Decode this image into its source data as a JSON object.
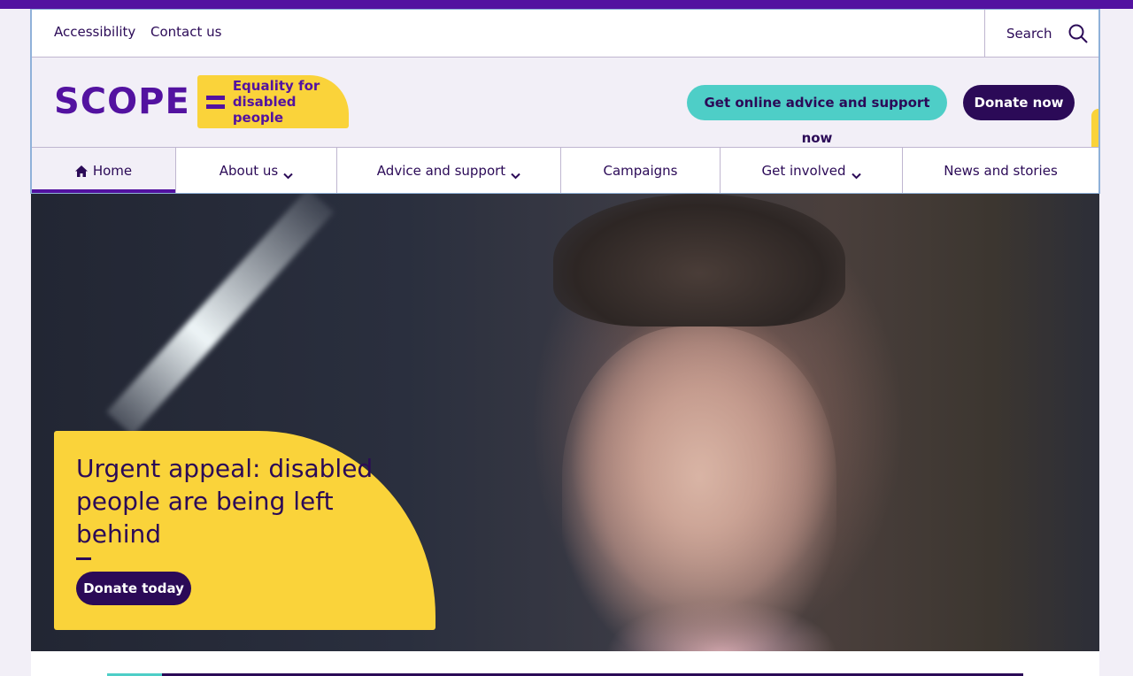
{
  "utility": {
    "links": [
      "Accessibility",
      "Contact us"
    ],
    "search_label": "Search"
  },
  "brand": {
    "name": "SCOPE",
    "tagline_line1": "Equality for",
    "tagline_line2": "disabled people"
  },
  "header_buttons": {
    "advice": "Get online advice and support now",
    "donate": "Donate now"
  },
  "nav": {
    "items": [
      {
        "label": "Home",
        "active": true,
        "dropdown": false
      },
      {
        "label": "About us",
        "active": false,
        "dropdown": true
      },
      {
        "label": "Advice and support",
        "active": false,
        "dropdown": true
      },
      {
        "label": "Campaigns",
        "active": false,
        "dropdown": false
      },
      {
        "label": "Get involved",
        "active": false,
        "dropdown": true
      },
      {
        "label": "News and stories",
        "active": false,
        "dropdown": false
      }
    ]
  },
  "hero": {
    "title": "Urgent appeal: disabled people are being left behind",
    "cta": "Donate today",
    "image_alt": "Young man looking at the camera"
  },
  "progress": {
    "fraction": 0.06
  },
  "colors": {
    "brand_purple": "#5312a0",
    "dark_purple": "#2b0a57",
    "teal": "#4ecec7",
    "yellow": "#fad33a",
    "background": "#f2eff7"
  }
}
